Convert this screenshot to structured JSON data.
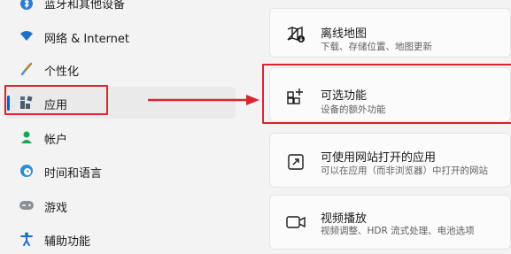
{
  "sidebar": {
    "items": [
      {
        "label": "蓝牙和其他设备",
        "icon": "bluetooth-icon"
      },
      {
        "label": "网络 & Internet",
        "icon": "wifi-icon"
      },
      {
        "label": "个性化",
        "icon": "brush-icon"
      },
      {
        "label": "应用",
        "icon": "apps-icon",
        "selected": true
      },
      {
        "label": "帐户",
        "icon": "person-icon"
      },
      {
        "label": "时间和语言",
        "icon": "globe-clock-icon"
      },
      {
        "label": "游戏",
        "icon": "gamepad-icon"
      },
      {
        "label": "辅助功能",
        "icon": "accessibility-icon"
      }
    ]
  },
  "cards": [
    {
      "title": "离线地图",
      "subtitle": "下载、存储位置、地图更新",
      "icon": "offline-map-icon"
    },
    {
      "title": "可选功能",
      "subtitle": "设备的额外功能",
      "icon": "optional-features-icon"
    },
    {
      "title": "可使用网站打开的应用",
      "subtitle": "可以在应用（而非浏览器）中打开的网站",
      "icon": "open-in-app-icon"
    },
    {
      "title": "视频播放",
      "subtitle": "视频调整、HDR 流式处理、电池选项",
      "icon": "video-icon"
    }
  ],
  "colors": {
    "accent": "#0067c0",
    "annotation_red": "#d7262e"
  }
}
